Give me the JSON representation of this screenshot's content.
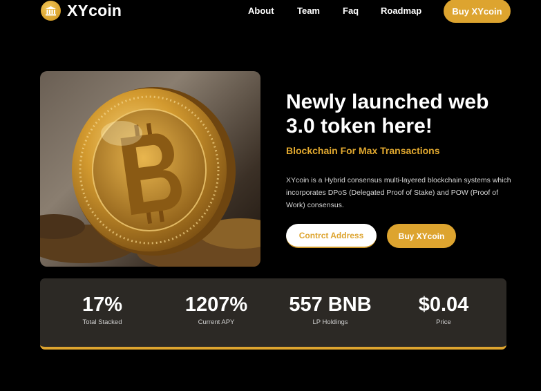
{
  "header": {
    "logo_text": "XYcoin",
    "nav": [
      "About",
      "Team",
      "Faq",
      "Roadmap"
    ],
    "buy_label": "Buy XYcoin"
  },
  "hero": {
    "image_subject": "golden bitcoin coin",
    "title": "Newly launched web 3.0 token here!",
    "subtitle": "Blockchain For Max Transactions",
    "description": "XYcoin is a Hybrid consensus multi-layered blockchain systems which incorporates DPoS (Delegated Proof of Stake) and POW (Proof of Work) consensus.",
    "contract_label": "Contrct Address",
    "buy_label": "Buy XYcoin"
  },
  "stats": [
    {
      "value": "17%",
      "label": "Total Stacked"
    },
    {
      "value": "1207%",
      "label": "Current APY"
    },
    {
      "value": "557 BNB",
      "label": "LP Holdings"
    },
    {
      "value": "$0.04",
      "label": "Price"
    }
  ],
  "colors": {
    "background": "#000000",
    "accent": "#dda42f",
    "stats_bg": "#2c2925"
  }
}
